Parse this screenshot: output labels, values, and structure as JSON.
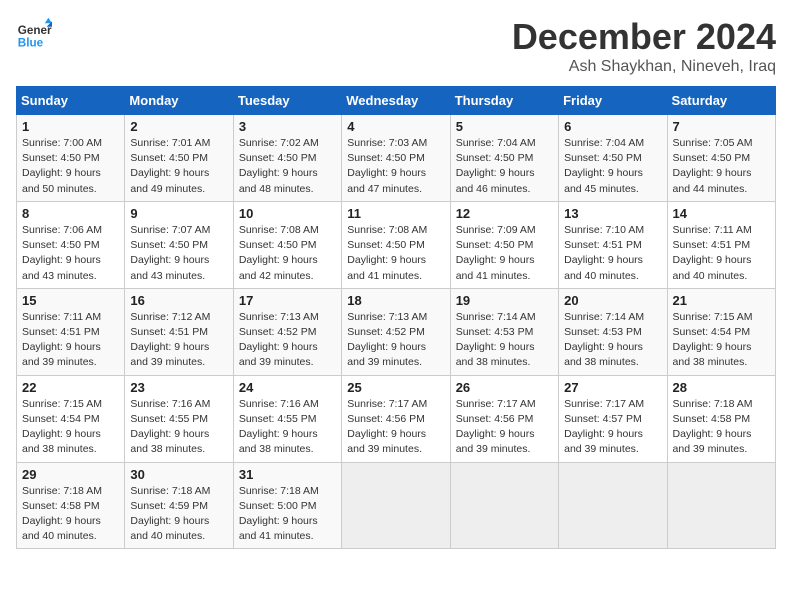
{
  "header": {
    "logo_line1": "General",
    "logo_line2": "Blue",
    "month_title": "December 2024",
    "location": "Ash Shaykhan, Nineveh, Iraq"
  },
  "columns": [
    "Sunday",
    "Monday",
    "Tuesday",
    "Wednesday",
    "Thursday",
    "Friday",
    "Saturday"
  ],
  "weeks": [
    [
      {
        "day": "1",
        "sunrise": "7:00 AM",
        "sunset": "4:50 PM",
        "daylight": "9 hours and 50 minutes."
      },
      {
        "day": "2",
        "sunrise": "7:01 AM",
        "sunset": "4:50 PM",
        "daylight": "9 hours and 49 minutes."
      },
      {
        "day": "3",
        "sunrise": "7:02 AM",
        "sunset": "4:50 PM",
        "daylight": "9 hours and 48 minutes."
      },
      {
        "day": "4",
        "sunrise": "7:03 AM",
        "sunset": "4:50 PM",
        "daylight": "9 hours and 47 minutes."
      },
      {
        "day": "5",
        "sunrise": "7:04 AM",
        "sunset": "4:50 PM",
        "daylight": "9 hours and 46 minutes."
      },
      {
        "day": "6",
        "sunrise": "7:04 AM",
        "sunset": "4:50 PM",
        "daylight": "9 hours and 45 minutes."
      },
      {
        "day": "7",
        "sunrise": "7:05 AM",
        "sunset": "4:50 PM",
        "daylight": "9 hours and 44 minutes."
      }
    ],
    [
      {
        "day": "8",
        "sunrise": "7:06 AM",
        "sunset": "4:50 PM",
        "daylight": "9 hours and 43 minutes."
      },
      {
        "day": "9",
        "sunrise": "7:07 AM",
        "sunset": "4:50 PM",
        "daylight": "9 hours and 43 minutes."
      },
      {
        "day": "10",
        "sunrise": "7:08 AM",
        "sunset": "4:50 PM",
        "daylight": "9 hours and 42 minutes."
      },
      {
        "day": "11",
        "sunrise": "7:08 AM",
        "sunset": "4:50 PM",
        "daylight": "9 hours and 41 minutes."
      },
      {
        "day": "12",
        "sunrise": "7:09 AM",
        "sunset": "4:50 PM",
        "daylight": "9 hours and 41 minutes."
      },
      {
        "day": "13",
        "sunrise": "7:10 AM",
        "sunset": "4:51 PM",
        "daylight": "9 hours and 40 minutes."
      },
      {
        "day": "14",
        "sunrise": "7:11 AM",
        "sunset": "4:51 PM",
        "daylight": "9 hours and 40 minutes."
      }
    ],
    [
      {
        "day": "15",
        "sunrise": "7:11 AM",
        "sunset": "4:51 PM",
        "daylight": "9 hours and 39 minutes."
      },
      {
        "day": "16",
        "sunrise": "7:12 AM",
        "sunset": "4:51 PM",
        "daylight": "9 hours and 39 minutes."
      },
      {
        "day": "17",
        "sunrise": "7:13 AM",
        "sunset": "4:52 PM",
        "daylight": "9 hours and 39 minutes."
      },
      {
        "day": "18",
        "sunrise": "7:13 AM",
        "sunset": "4:52 PM",
        "daylight": "9 hours and 39 minutes."
      },
      {
        "day": "19",
        "sunrise": "7:14 AM",
        "sunset": "4:53 PM",
        "daylight": "9 hours and 38 minutes."
      },
      {
        "day": "20",
        "sunrise": "7:14 AM",
        "sunset": "4:53 PM",
        "daylight": "9 hours and 38 minutes."
      },
      {
        "day": "21",
        "sunrise": "7:15 AM",
        "sunset": "4:54 PM",
        "daylight": "9 hours and 38 minutes."
      }
    ],
    [
      {
        "day": "22",
        "sunrise": "7:15 AM",
        "sunset": "4:54 PM",
        "daylight": "9 hours and 38 minutes."
      },
      {
        "day": "23",
        "sunrise": "7:16 AM",
        "sunset": "4:55 PM",
        "daylight": "9 hours and 38 minutes."
      },
      {
        "day": "24",
        "sunrise": "7:16 AM",
        "sunset": "4:55 PM",
        "daylight": "9 hours and 38 minutes."
      },
      {
        "day": "25",
        "sunrise": "7:17 AM",
        "sunset": "4:56 PM",
        "daylight": "9 hours and 39 minutes."
      },
      {
        "day": "26",
        "sunrise": "7:17 AM",
        "sunset": "4:56 PM",
        "daylight": "9 hours and 39 minutes."
      },
      {
        "day": "27",
        "sunrise": "7:17 AM",
        "sunset": "4:57 PM",
        "daylight": "9 hours and 39 minutes."
      },
      {
        "day": "28",
        "sunrise": "7:18 AM",
        "sunset": "4:58 PM",
        "daylight": "9 hours and 39 minutes."
      }
    ],
    [
      {
        "day": "29",
        "sunrise": "7:18 AM",
        "sunset": "4:58 PM",
        "daylight": "9 hours and 40 minutes."
      },
      {
        "day": "30",
        "sunrise": "7:18 AM",
        "sunset": "4:59 PM",
        "daylight": "9 hours and 40 minutes."
      },
      {
        "day": "31",
        "sunrise": "7:18 AM",
        "sunset": "5:00 PM",
        "daylight": "9 hours and 41 minutes."
      },
      null,
      null,
      null,
      null
    ]
  ]
}
